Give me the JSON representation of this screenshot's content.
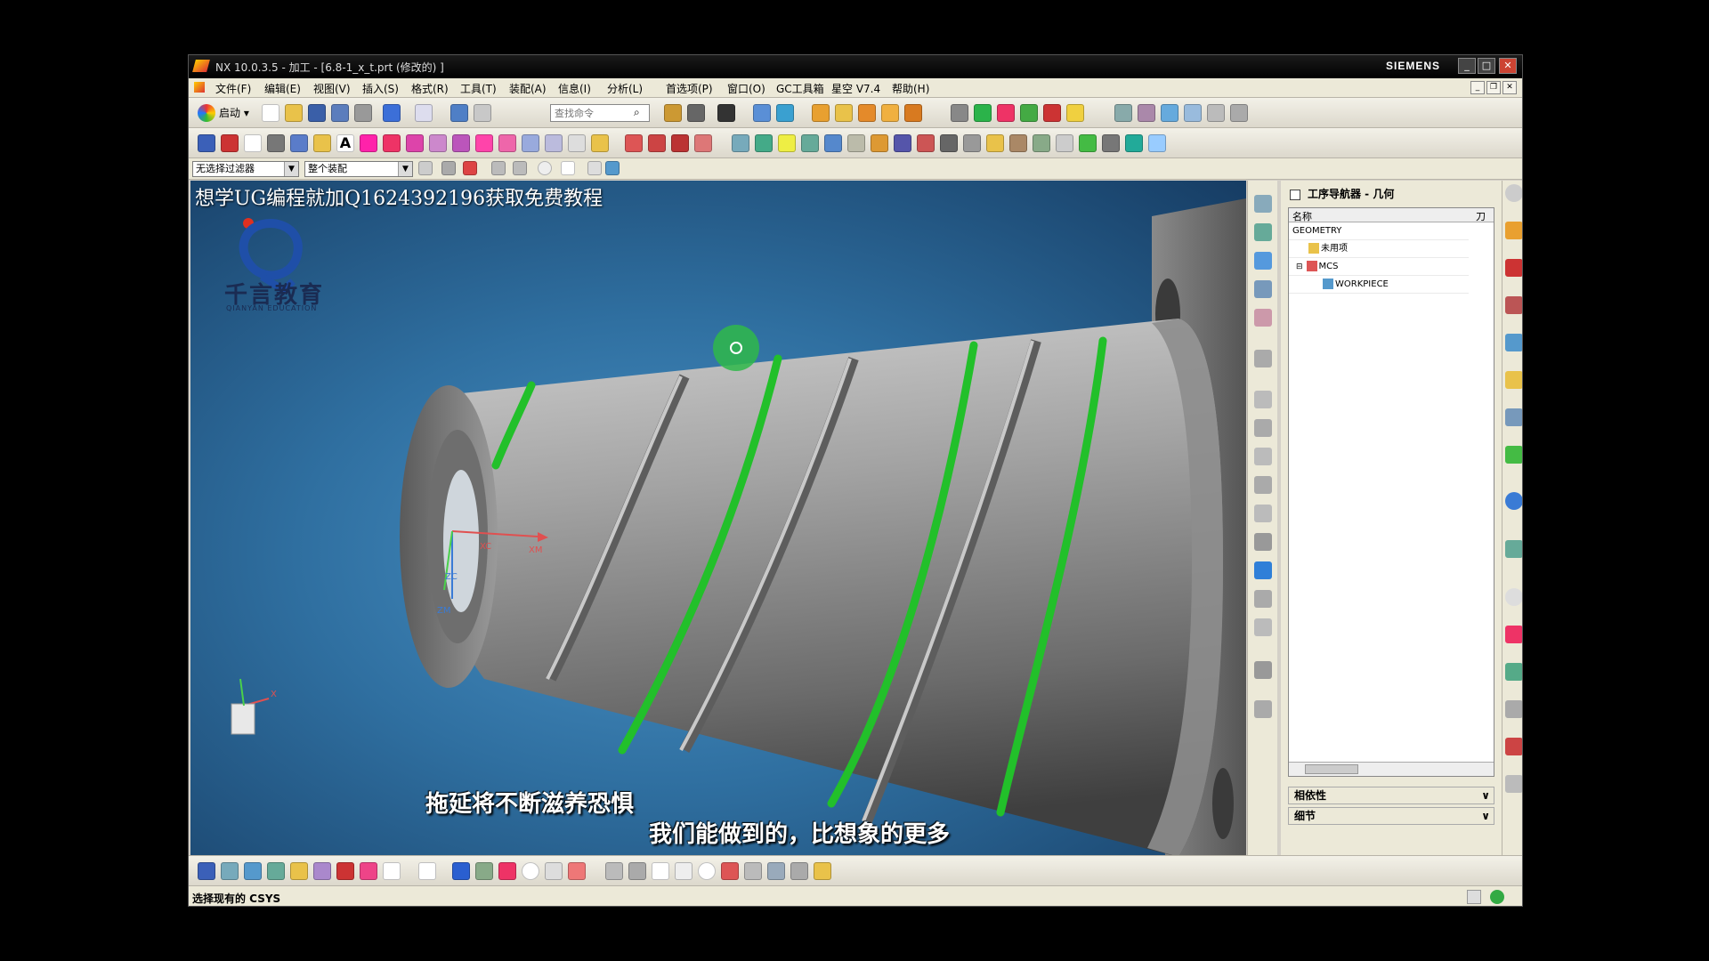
{
  "window": {
    "title": "NX 10.0.3.5 - 加工 - [6.8-1_x_t.prt  (修改的) ]",
    "brand": "SIEMENS",
    "minimize": "_",
    "maximize": "□",
    "close": "✕"
  },
  "menu": {
    "items": [
      "文件(F)",
      "编辑(E)",
      "视图(V)",
      "插入(S)",
      "格式(R)",
      "工具(T)",
      "装配(A)",
      "信息(I)",
      "分析(L)",
      "首选项(P)",
      "窗口(O)",
      "GC工具箱",
      "星空 V7.4",
      "帮助(H)"
    ]
  },
  "toolbar": {
    "start_label": "启动",
    "search_placeholder": "查找命令"
  },
  "filter": {
    "selection_filter": "无选择过滤器",
    "assembly_scope": "整个装配"
  },
  "viewport": {
    "watermark": "想学UG编程就加Q1624392196获取免费教程",
    "logo_text": "千言教育",
    "logo_sub": "QIANYAN EDUCATION",
    "axis_xc": "XC",
    "axis_xm": "XM",
    "axis_zc": "ZC",
    "axis_zm": "ZM",
    "triad_x": "X",
    "subtitle_1": "拖延将不断滋养恐惧",
    "subtitle_2": "我们能做到的，比想象的更多"
  },
  "navigator": {
    "title": "工序导航器 - 几何",
    "col_name": "名称",
    "col_tool": "刀",
    "rows": [
      {
        "label": "GEOMETRY",
        "indent": 0
      },
      {
        "label": "未用项",
        "indent": 1
      },
      {
        "label": "MCS",
        "indent": 1
      },
      {
        "label": "WORKPIECE",
        "indent": 2
      }
    ],
    "section_dependencies": "相依性",
    "section_details": "细节"
  },
  "status": {
    "text": "选择现有的 CSYS"
  },
  "colors": {
    "viewport_bg": "#2f6fa0",
    "groove_green": "#22c02a",
    "part_gray": "#9a9a9a"
  }
}
